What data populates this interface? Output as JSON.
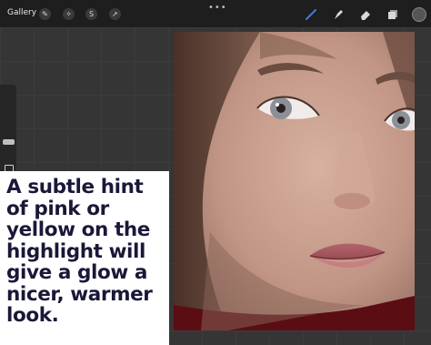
{
  "toolbar": {
    "gallery_label": "Gallery",
    "left_tools": [
      {
        "icon": "wrench-icon",
        "glyph": "✎"
      },
      {
        "icon": "magic-wand-icon",
        "glyph": "✧"
      },
      {
        "icon": "selection-icon",
        "glyph": "S"
      },
      {
        "icon": "transform-arrow-icon",
        "glyph": "➚"
      }
    ],
    "more_label": "•••",
    "right_tools": [
      "brush-icon",
      "smudge-icon",
      "eraser-icon",
      "layers-icon"
    ],
    "color_swatch": "#555555"
  },
  "caption": {
    "text": "A subtle hint of pink or yellow on the highlight will give a glow a nicer, warmer look."
  },
  "colors": {
    "caption_text": "#1a1838",
    "active_tool": "#3b7ddd"
  }
}
